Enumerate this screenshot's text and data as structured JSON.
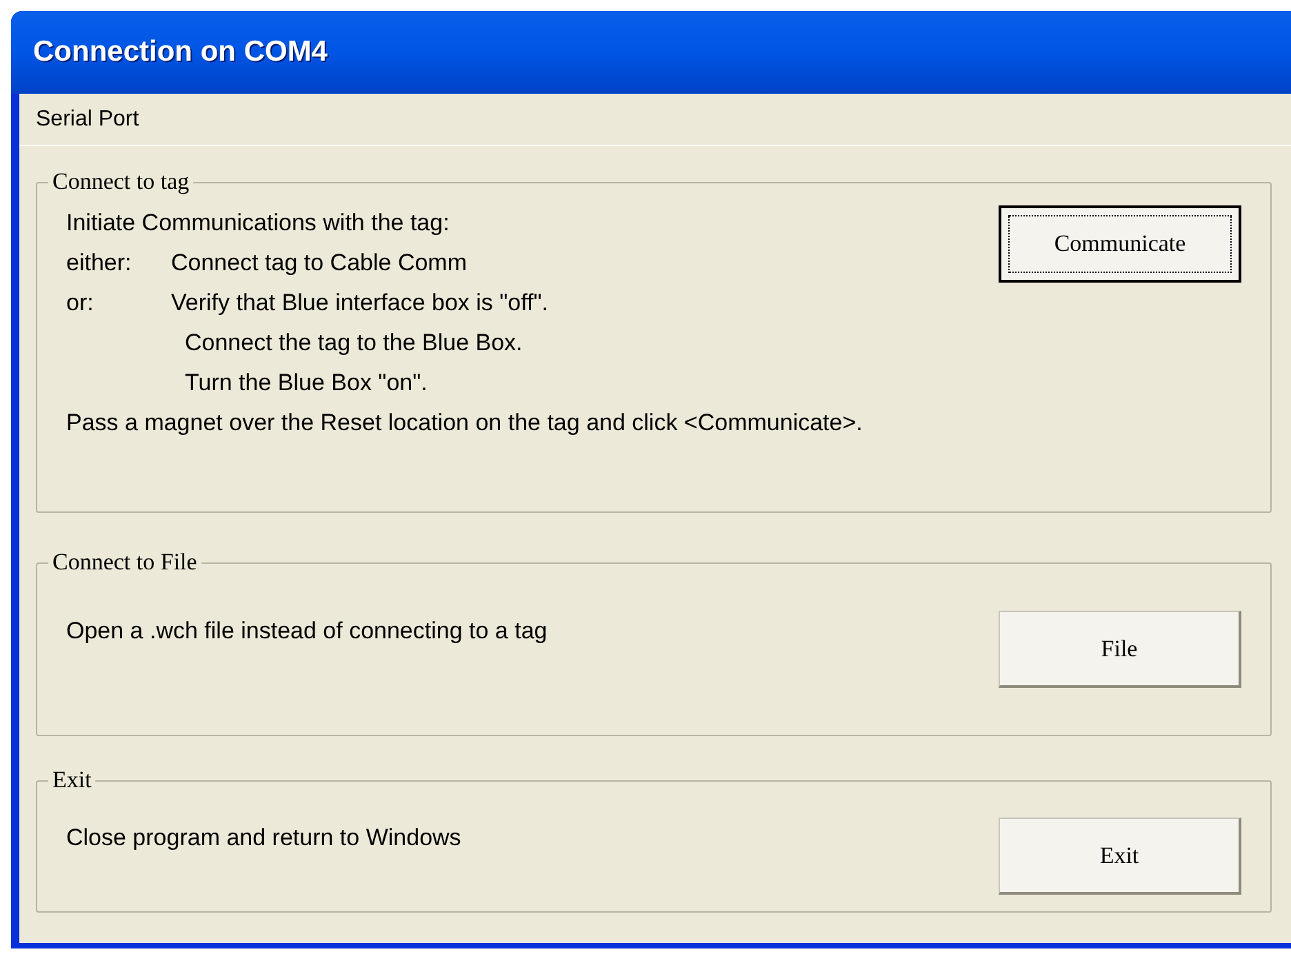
{
  "window": {
    "title": "Connection on COM4"
  },
  "menu": [
    "Serial Port"
  ],
  "groups": [
    {
      "legend": "Connect to tag",
      "lines": [
        {
          "kind": "plain",
          "text": "Initiate Communications with the tag:"
        },
        {
          "kind": "labeled",
          "prefix": "either:",
          "text": "Connect tag to Cable Comm"
        },
        {
          "kind": "labeled",
          "prefix": "or:",
          "text": "Verify that Blue interface box is \"off\"."
        },
        {
          "kind": "continued",
          "text": "Connect the tag to the Blue Box."
        },
        {
          "kind": "continued",
          "text": "Turn the Blue Box \"on\"."
        },
        {
          "kind": "plain",
          "text": "Pass a magnet over the Reset location on the tag and click <Communicate>."
        }
      ],
      "button": {
        "label": "Communicate",
        "focused": true
      }
    },
    {
      "legend": "Connect to File",
      "lines": [
        {
          "kind": "plain",
          "text": "Open a .wch file instead of connecting to a tag"
        }
      ],
      "button": {
        "label": "File",
        "focused": false
      }
    },
    {
      "legend": "Exit",
      "lines": [
        {
          "kind": "plain",
          "text": "Close program and return to Windows"
        }
      ],
      "button": {
        "label": "Exit",
        "focused": false
      }
    }
  ]
}
